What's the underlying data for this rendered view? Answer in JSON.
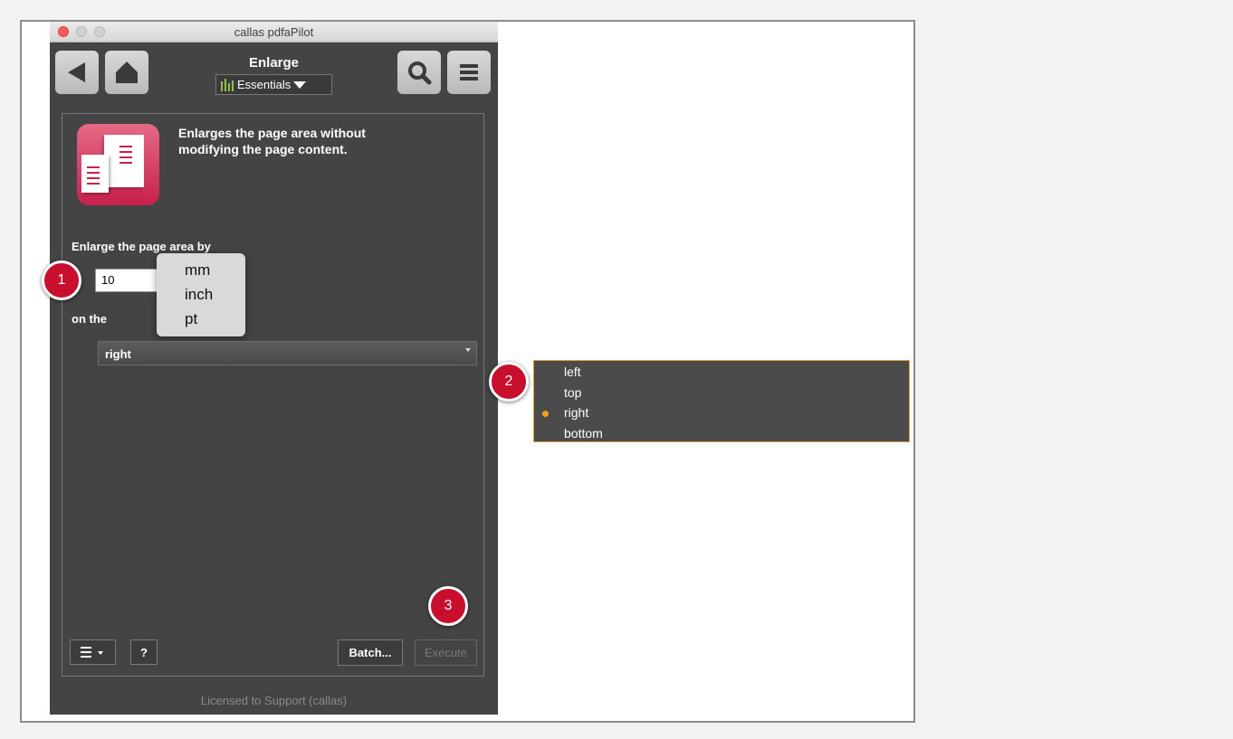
{
  "window": {
    "title": "callas pdfaPilot"
  },
  "toolbar": {
    "tool_title": "Enlarge",
    "profile_menu": "Essentials",
    "icons": [
      "back-icon",
      "home-icon",
      "search-icon",
      "menu-icon"
    ]
  },
  "tool": {
    "description_line1": "Enlarges the page area without",
    "description_line2": "modifying the page content."
  },
  "form": {
    "enlarge_label": "Enlarge the page area by",
    "amount_value": "10",
    "units": [
      "mm",
      "inch",
      "pt"
    ],
    "on_the_label": "on the",
    "side_value": "right",
    "side_options": [
      "left",
      "top",
      "right",
      "bottom"
    ]
  },
  "footer": {
    "batch_label": "Batch...",
    "execute_label": "Execute",
    "help_label": "?",
    "license_text": "Licensed to Support (callas)"
  },
  "callouts": [
    "1",
    "2",
    "3"
  ],
  "colors": {
    "panel_bg": "#444444",
    "callout": "#c8102e",
    "selection_dot": "#f0a020",
    "dropdown_border": "#e0a040"
  }
}
